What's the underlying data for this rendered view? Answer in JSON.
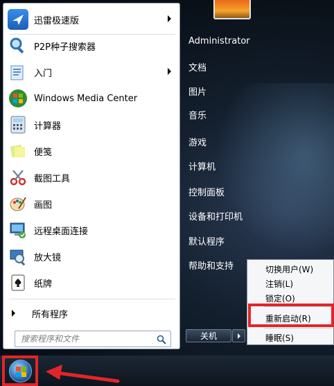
{
  "start_menu": {
    "programs": [
      {
        "label": "迅雷极速版",
        "icon": "thunder-bird-icon",
        "has_submenu": true
      },
      {
        "label": "P2P种子搜索器",
        "icon": "magnifier-icon",
        "has_submenu": false
      },
      {
        "label": "入门",
        "icon": "getting-started-icon",
        "has_submenu": true
      },
      {
        "label": "Windows Media Center",
        "icon": "windows-media-center-icon",
        "has_submenu": false
      },
      {
        "label": "计算器",
        "icon": "calculator-icon",
        "has_submenu": false
      },
      {
        "label": "便笺",
        "icon": "sticky-notes-icon",
        "has_submenu": false
      },
      {
        "label": "截图工具",
        "icon": "snipping-tool-icon",
        "has_submenu": false
      },
      {
        "label": "画图",
        "icon": "paint-icon",
        "has_submenu": false
      },
      {
        "label": "远程桌面连接",
        "icon": "remote-desktop-icon",
        "has_submenu": false
      },
      {
        "label": "放大镜",
        "icon": "magnifier-tool-icon",
        "has_submenu": false
      },
      {
        "label": "纸牌",
        "icon": "solitaire-icon",
        "has_submenu": false
      }
    ],
    "all_programs_label": "所有程序",
    "search_placeholder": "搜索程序和文件"
  },
  "right_pane": {
    "user": "Administrator",
    "items": [
      "文档",
      "图片",
      "音乐",
      "游戏",
      "计算机",
      "控制面板",
      "设备和打印机",
      "默认程序",
      "帮助和支持"
    ],
    "shutdown_label": "关机"
  },
  "context_menu": {
    "items": [
      "切换用户(W)",
      "注销(L)",
      "锁定(O)",
      "重新启动(R)",
      "睡眠(S)"
    ]
  },
  "colors": {
    "highlight_border": "#e0262a"
  }
}
